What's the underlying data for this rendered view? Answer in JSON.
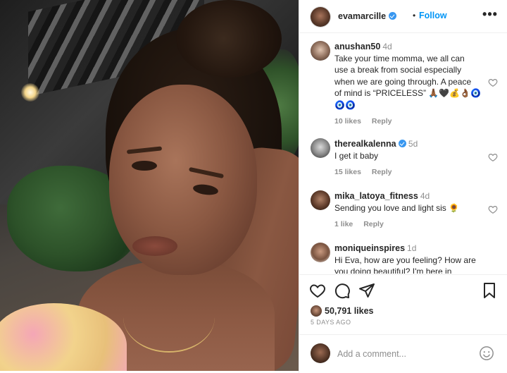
{
  "post": {
    "photo_description_icon": "selfie-photo",
    "header": {
      "username": "evamarcille",
      "separator": "•",
      "follow_label": "Follow",
      "more_icon": "more-horizontal-icon",
      "more_label": "•••"
    },
    "comments": [
      {
        "username": "anushan50",
        "time": "4d",
        "verified": false,
        "text_lines": [
          "Take your time momma, we all can",
          "use a break from social especially",
          "when we are going through. A peace",
          "of mind is “PRICELESS” 🙏🏾🖤💰👌🏾🧿",
          "🧿🧿"
        ],
        "likes": "10 likes",
        "reply": "Reply"
      },
      {
        "username": "therealkalenna",
        "time": "5d",
        "verified": true,
        "text_lines": [
          "I get it baby"
        ],
        "likes": "15 likes",
        "reply": "Reply"
      },
      {
        "username": "mika_latoya_fitness",
        "time": "4d",
        "verified": false,
        "text_lines": [
          "Sending you love and light sis 🌻"
        ],
        "likes": "1 like",
        "reply": "Reply"
      },
      {
        "username": "moniqueinspires",
        "time": "1d",
        "verified": false,
        "text_lines": [
          "Hi Eva, how are you feeling? How are",
          "you doing beautiful? I'm here in"
        ],
        "likes": "",
        "reply": ""
      }
    ],
    "actions": {
      "like_icon": "heart-outline-icon",
      "comment_icon": "comment-bubble-icon",
      "share_icon": "paper-plane-icon",
      "save_icon": "bookmark-icon",
      "likes_count": "50,791 likes",
      "date": "5 DAYS AGO"
    },
    "add_comment": {
      "placeholder": "Add a comment...",
      "emoji_icon": "smiley-face-icon"
    }
  }
}
